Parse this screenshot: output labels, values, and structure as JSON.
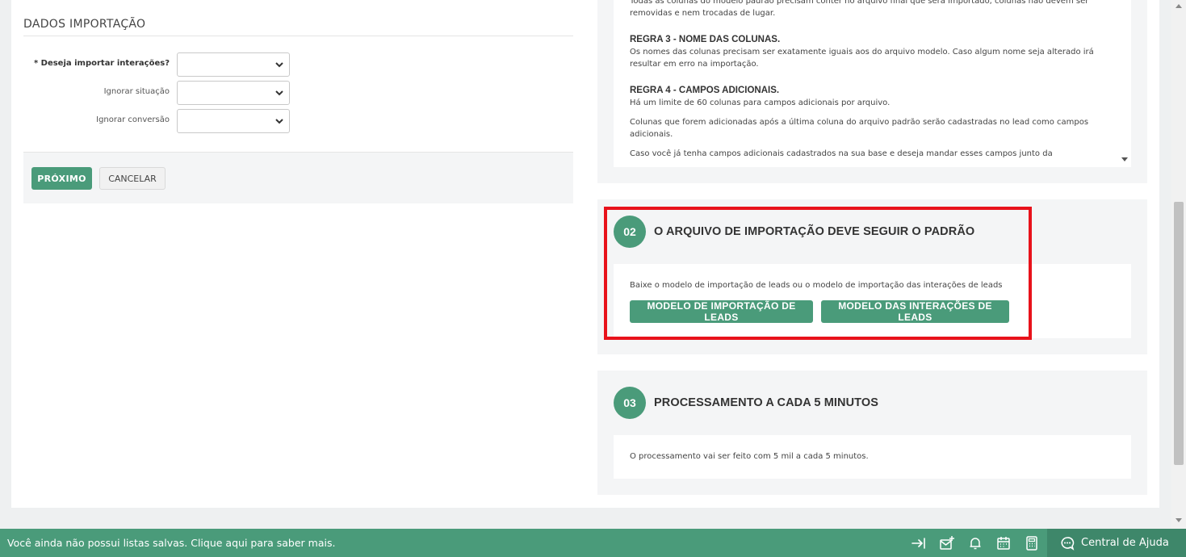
{
  "form": {
    "section_title": "DADOS IMPORTAÇÃO",
    "fields": [
      {
        "label": "* Deseja importar interações?",
        "value": ""
      },
      {
        "label": "Ignorar situação",
        "value": ""
      },
      {
        "label": "Ignorar conversão",
        "value": ""
      }
    ],
    "next_label": "PRÓXIMO",
    "cancel_label": "CANCELAR"
  },
  "rules": {
    "rule2_text": "Todas as colunas do modelo padrão precisam conter no arquivo final que será importado, colunas não devem ser removidas e nem trocadas de lugar.",
    "rule3_title": "REGRA 3 - NOME DAS COLUNAS.",
    "rule3_text": "Os nomes das colunas precisam ser exatamente iguais aos do arquivo modelo. Caso algum nome seja alterado irá resultar em erro na importação.",
    "rule4_title": "REGRA 4 - CAMPOS ADICIONAIS.",
    "rule4_text1": "Há um limite de 60 colunas para campos adicionais por arquivo.",
    "rule4_text2": "Colunas que forem adicionadas após a última coluna do arquivo padrão serão cadastradas no lead como campos adicionais.",
    "rule4_text3": "Caso você já tenha campos adicionais cadastrados na sua base e deseja mandar esses campos junto da"
  },
  "step2": {
    "number": "02",
    "title": "O ARQUIVO DE IMPORTAÇÃO DEVE SEGUIR O PADRÃO",
    "text": "Baixe o modelo de importação de leads ou o modelo de importação das interações de leads",
    "button_leads": "MODELO DE IMPORTAÇÃO DE LEADS",
    "button_interactions": "MODELO DAS INTERAÇÕES DE LEADS"
  },
  "step3": {
    "number": "03",
    "title": "PROCESSAMENTO A CADA 5 MINUTOS",
    "text": "O processamento vai ser feito com 5 mil a cada 5 minutos."
  },
  "footer": {
    "message": "Você ainda não possui listas salvas. Clique aqui para saber mais.",
    "help_label": "Central de Ajuda"
  },
  "colors": {
    "accent": "#4a9b7a",
    "highlight": "#e8121b"
  }
}
